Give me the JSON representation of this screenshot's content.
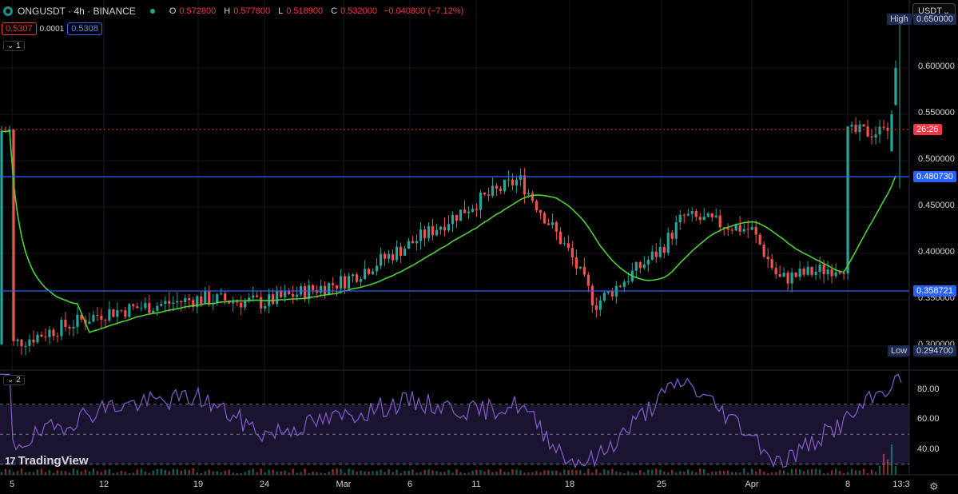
{
  "header": {
    "symbol_title": "ONGUSDT · 4h · BINANCE",
    "open_label": "O",
    "open_value": "0.572800",
    "high_label": "H",
    "high_value": "0.577600",
    "low_label": "L",
    "low_value": "0.518900",
    "close_label": "C",
    "close_value": "0.532000",
    "change_value": "−0.040800 (−7.12%)"
  },
  "spread": {
    "sell": "0.5307",
    "spread": "0.0001",
    "buy": "0.5308"
  },
  "panes": {
    "main_label": "1",
    "rsi_label": "2"
  },
  "currency": {
    "label": "USDT",
    "chevron_icon": "chevron-down-icon"
  },
  "price_axis": {
    "labels": [
      "0.600000",
      "0.550000",
      "0.500000",
      "0.450000",
      "0.400000",
      "0.350000",
      "0.300000"
    ],
    "high_tag": "High",
    "high_value": "0.650000",
    "low_tag": "Low",
    "low_value": "0.294700",
    "support_high": "0.480730",
    "support_low": "0.358721",
    "countdown": "26:26"
  },
  "rsi_axis": {
    "labels": [
      "80.00",
      "60.00",
      "40.00"
    ]
  },
  "time_axis": {
    "labels": [
      "5",
      "12",
      "19",
      "24",
      "Mar",
      "6",
      "11",
      "18",
      "25",
      "Apr",
      "8",
      "13:3"
    ]
  },
  "brand": {
    "name": "TradingView",
    "mark": "17"
  },
  "colors": {
    "up": "#26a69a",
    "down": "#ef5350",
    "ma": "#4cd137",
    "hline": "#2962ff",
    "rsi": "#7e57c2",
    "price_line": "#f23645"
  },
  "chart_data": [
    {
      "type": "candlestick",
      "symbol": "ONGUSDT",
      "interval": "4h",
      "exchange": "BINANCE",
      "x_range": [
        "5",
        "13:3"
      ],
      "ylim": [
        0.29,
        0.66
      ],
      "approx_close_path": [
        [
          "5",
          0.302
        ],
        [
          "12",
          0.336
        ],
        [
          "19",
          0.351
        ],
        [
          "24",
          0.347
        ],
        [
          "Mar",
          0.37
        ],
        [
          "6",
          0.41
        ],
        [
          "11",
          0.455
        ],
        [
          "13",
          0.48
        ],
        [
          "18",
          0.4
        ],
        [
          "21",
          0.345
        ],
        [
          "25",
          0.405
        ],
        [
          "27",
          0.44
        ],
        [
          "Apr",
          0.425
        ],
        [
          "3",
          0.372
        ],
        [
          "8",
          0.388
        ],
        [
          "12",
          0.5
        ],
        [
          "13:3",
          0.532
        ]
      ],
      "overlays": [
        {
          "name": "moving average",
          "color": "#4cd137"
        },
        {
          "name": "horizontal line",
          "value": 0.48073
        },
        {
          "name": "horizontal line",
          "value": 0.358721
        }
      ],
      "high": 0.65,
      "low": 0.2947,
      "last": 0.532
    },
    {
      "type": "line",
      "ylim": [
        25,
        90
      ],
      "levels": [
        70,
        50,
        30
      ],
      "approx_values": [
        [
          "5",
          42
        ],
        [
          "12",
          68
        ],
        [
          "19",
          75
        ],
        [
          "24",
          50
        ],
        [
          "Mar",
          62
        ],
        [
          "6",
          72
        ],
        [
          "11",
          65
        ],
        [
          "13",
          70
        ],
        [
          "18",
          32
        ],
        [
          "21",
          33
        ],
        [
          "25",
          75
        ],
        [
          "27",
          86
        ],
        [
          "Apr",
          50
        ],
        [
          "3",
          30
        ],
        [
          "8",
          60
        ],
        [
          "13:3",
          89
        ]
      ]
    }
  ]
}
